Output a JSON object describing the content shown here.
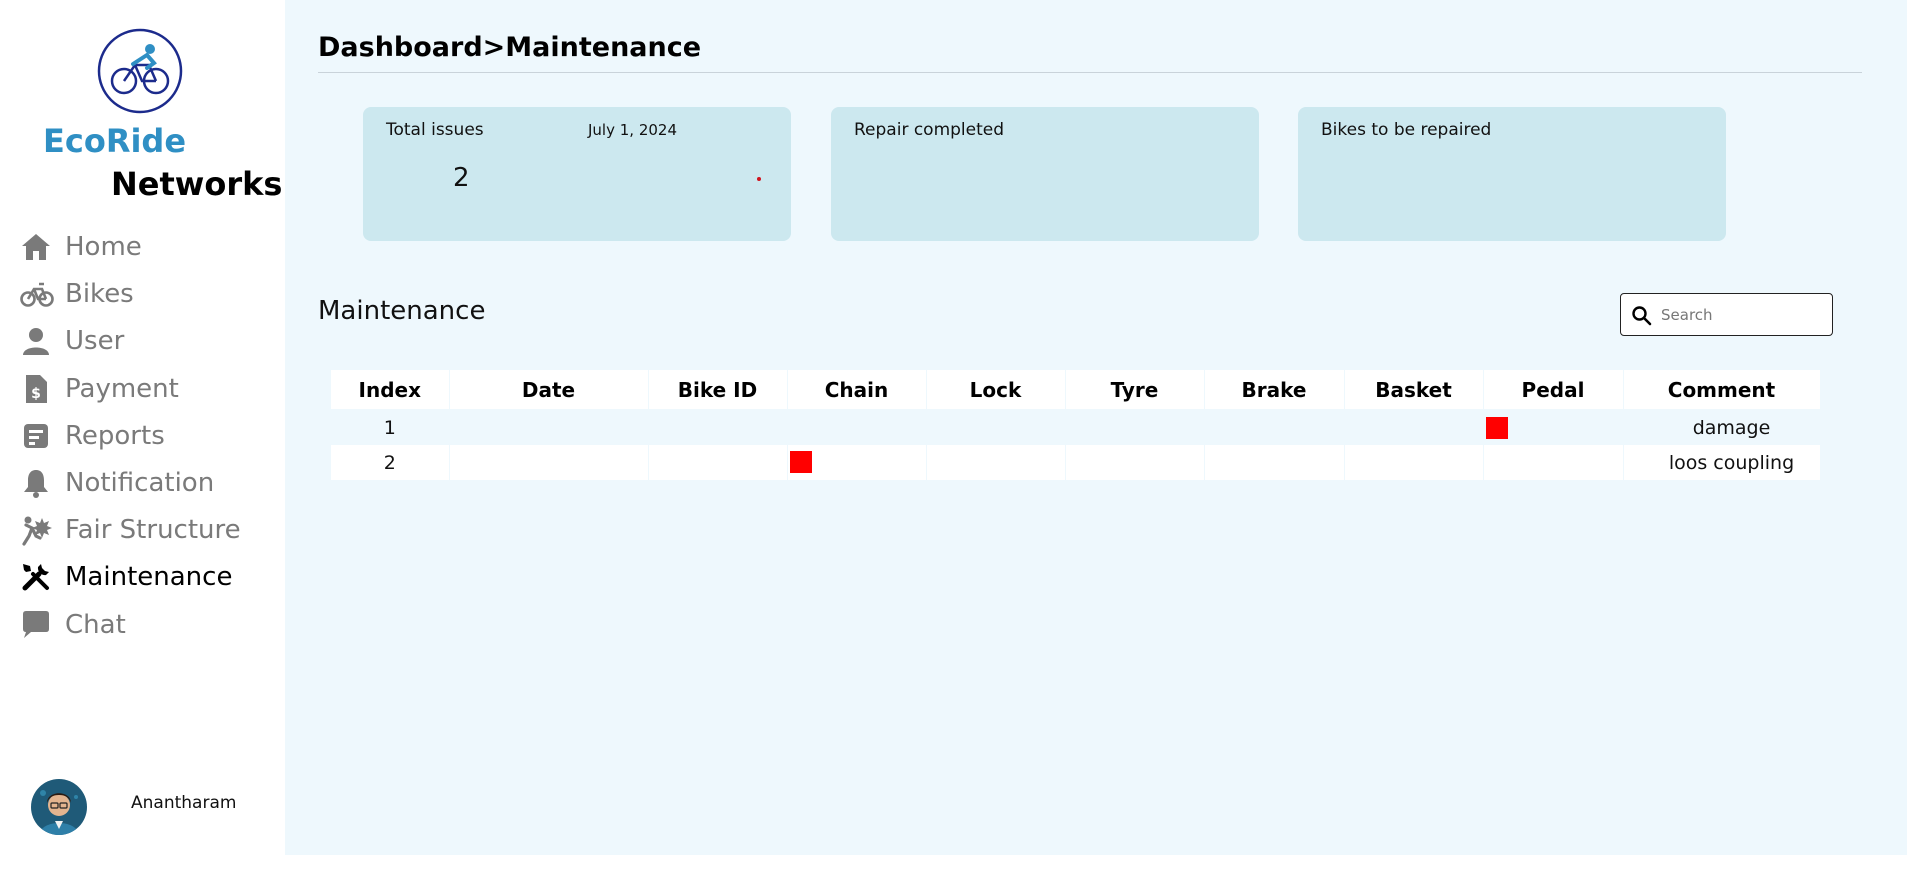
{
  "app": {
    "brand_line1": "EcoRide",
    "brand_line2": "Networks"
  },
  "sidebar": {
    "items": [
      {
        "label": "Home",
        "icon": "home-icon",
        "active": false
      },
      {
        "label": "Bikes",
        "icon": "bike-icon",
        "active": false
      },
      {
        "label": "User",
        "icon": "user-icon",
        "active": false
      },
      {
        "label": "Payment",
        "icon": "receipt-icon",
        "active": false
      },
      {
        "label": "Reports",
        "icon": "report-icon",
        "active": false
      },
      {
        "label": "Notification",
        "icon": "bell-icon",
        "active": false
      },
      {
        "label": "Fair Structure",
        "icon": "fare-icon",
        "active": false
      },
      {
        "label": "Maintenance",
        "icon": "tools-icon",
        "active": true
      },
      {
        "label": "Chat",
        "icon": "chat-icon",
        "active": false
      }
    ],
    "user": {
      "name": "Anantharam"
    }
  },
  "header": {
    "breadcrumb": "Dashboard>Maintenance"
  },
  "cards": [
    {
      "title": "Total issues",
      "date": "July 1, 2024",
      "count": "2"
    },
    {
      "title": "Repair completed"
    },
    {
      "title": "Bikes to be repaired"
    }
  ],
  "section": {
    "title": "Maintenance"
  },
  "search": {
    "placeholder": "Search",
    "value": ""
  },
  "table": {
    "columns": [
      "Index",
      "Date",
      "Bike ID",
      "Chain",
      "Lock",
      "Tyre",
      "Brake",
      "Basket",
      "Pedal",
      "Comment"
    ],
    "rows": [
      {
        "index": "1",
        "date": "",
        "bike_id": "",
        "flags": {
          "chain": false,
          "lock": false,
          "tyre": false,
          "brake": false,
          "basket": false,
          "pedal": true
        },
        "comment": "damage"
      },
      {
        "index": "2",
        "date": "",
        "bike_id": "",
        "flags": {
          "chain": true,
          "lock": false,
          "tyre": false,
          "brake": false,
          "basket": false,
          "pedal": false
        },
        "comment": "loos coupling"
      }
    ]
  },
  "colors": {
    "brand_blue": "#2f8fc4",
    "main_bg": "#eef8fd",
    "card_bg": "#cce8ef",
    "flag_red": "#ff0000",
    "nav_inactive": "#7a7a7a",
    "nav_active": "#000000"
  }
}
